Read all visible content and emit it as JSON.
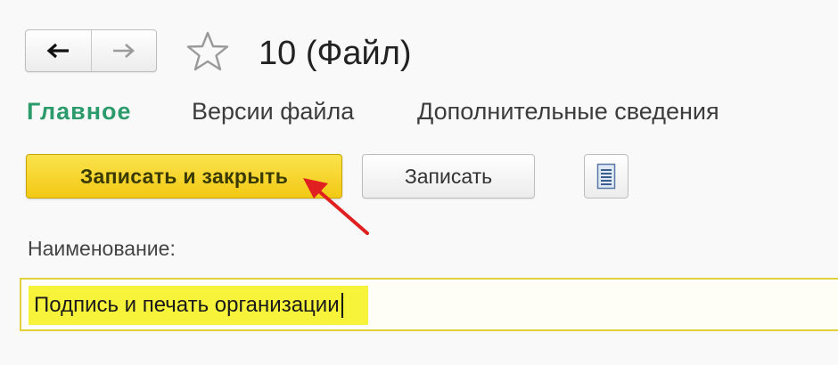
{
  "header": {
    "back_icon": "arrow-left-icon",
    "forward_icon": "arrow-right-icon",
    "favorite_icon": "star-outline-icon",
    "title": "10 (Файл)"
  },
  "tabs": [
    {
      "label": "Главное",
      "active": true
    },
    {
      "label": "Версии файла",
      "active": false
    },
    {
      "label": "Дополнительные сведения",
      "active": false
    }
  ],
  "toolbar": {
    "save_close_label": "Записать и закрыть",
    "save_label": "Записать",
    "more_icon": "list-menu-icon"
  },
  "annotation": {
    "icon": "red-arrow-icon",
    "color": "#e02020"
  },
  "form": {
    "name_label": "Наименование:",
    "name_value": "Подпись и печать организации"
  },
  "colors": {
    "accent_green": "#2c9b6c",
    "primary_button": "#f2c914",
    "field_highlight": "#f6f33a"
  }
}
